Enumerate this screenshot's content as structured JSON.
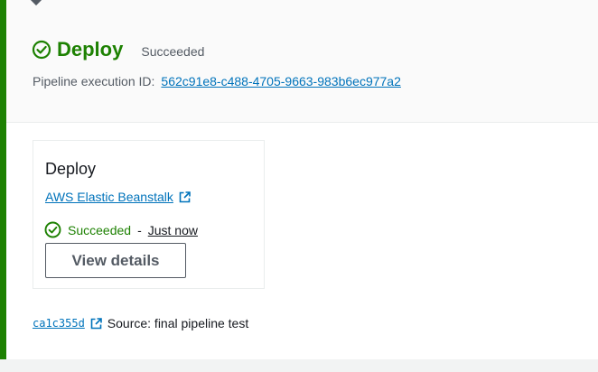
{
  "stage": {
    "title": "Deploy",
    "status": "Succeeded",
    "execution_label": "Pipeline execution ID:",
    "execution_id": "562c91e8-c488-4705-9663-983b6ec977a2"
  },
  "action": {
    "name": "Deploy",
    "provider": "AWS Elastic Beanstalk",
    "status": "Succeeded",
    "separator": "-",
    "time": "Just now",
    "view_details_label": "View details"
  },
  "source": {
    "commit_id": "ca1c355d",
    "text": "Source: final pipeline test"
  },
  "colors": {
    "success": "#1d8102",
    "link": "#0073bb",
    "muted": "#545b64"
  },
  "icons": {
    "stage_status": "check-circle-icon",
    "action_status": "check-circle-icon",
    "provider_link": "external-link-icon",
    "commit_link": "external-link-icon",
    "connector": "connector-arrow-icon"
  }
}
